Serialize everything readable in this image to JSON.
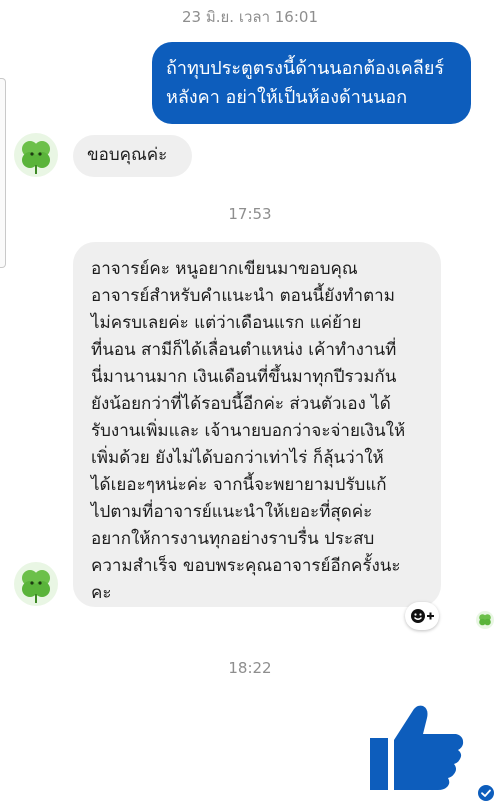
{
  "chat": {
    "timestamps": {
      "first": "23 มิ.ย. เวลา 16:01",
      "second": "17:53",
      "third": "18:22"
    },
    "messages": {
      "outgoing_1": {
        "lines": [
          "ถ้าทุบประตูตรงนี้ด้านนอกต้องเคลียร์",
          "หลังคา อย่าให้เป็นห้องด้านนอก"
        ]
      },
      "incoming_1": {
        "text": "ขอบคุณค่ะ"
      },
      "incoming_2": {
        "lines": [
          "อาจารย์คะ หนูอยากเขียนมาขอบคุณ",
          "อาจารย์สำหรับคำแนะนำ ตอนนี้ยังทำตาม",
          "ไม่ครบเลยค่ะ แต่ว่าเดือนแรก แค่ย้าย",
          "ที่นอน สามีก็ได้เลื่อนตำแหน่ง เค้าทำงานที่",
          "นี่มานานมาก เงินเดือนที่ขึ้นมาทุกปีรวมกัน",
          "ยังน้อยกว่าที่ได้รอบนี้อีกค่ะ ส่วนตัวเอง ได้",
          "รับงานเพิ่มและ เจ้านายบอกว่าจะจ่ายเงินให้",
          "เพิ่มด้วย ยังไม่ได้บอกว่าเท่าไร่ ก็ลุ้นว่าให้",
          "ได้เยอะๆหน่ะค่ะ จากนี้จะพยายามปรับแก้",
          "ไปตามที่อาจารย์แนะนำให้เยอะที่สุดค่ะ",
          "อยากให้การงานทุกอย่างราบรื่น ประสบ",
          "ความสำเร็จ ขอบพระคุณอาจารย์อีกครั้งนะ",
          "คะ"
        ]
      }
    },
    "icons": {
      "avatar": "clover-avatar-icon",
      "reaction": "add-reaction-icon",
      "like": "thumbs-up-icon",
      "seen": "seen-check-icon"
    },
    "colors": {
      "outgoing_bubble": "#0d5dbc",
      "incoming_bubble": "#efefef",
      "like": "#0d5dbc"
    }
  }
}
